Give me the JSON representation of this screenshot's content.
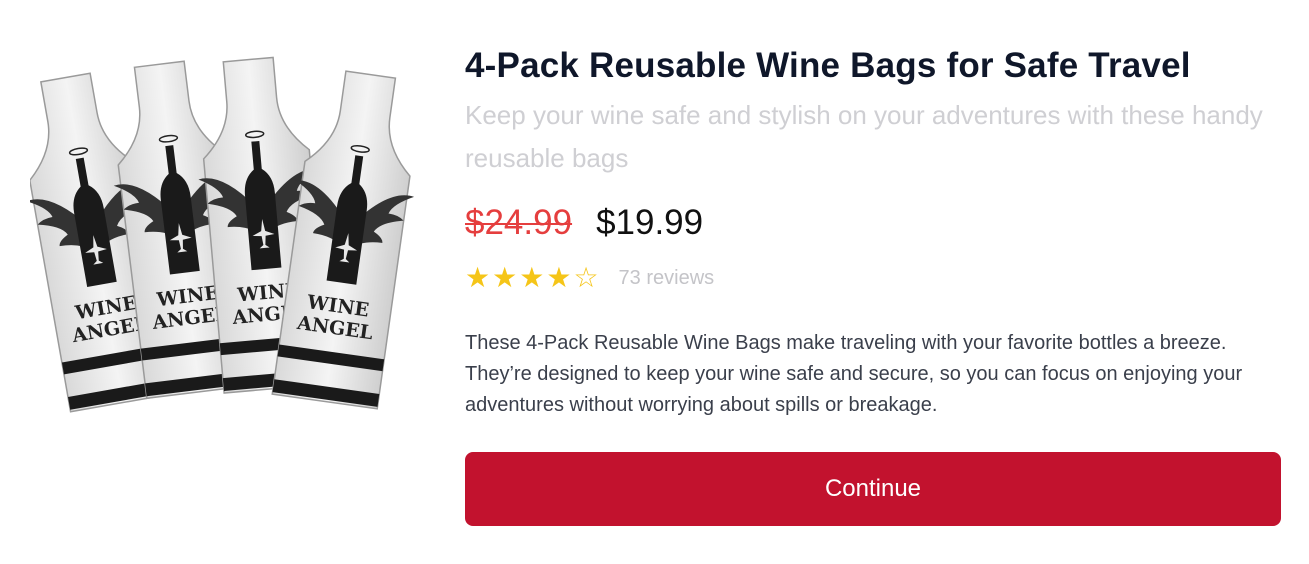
{
  "product": {
    "title": "4-Pack Reusable Wine Bags for Safe Travel",
    "subtitle": "Keep your wine safe and stylish on your adventures with these handy reusable bags",
    "original_price": "$24.99",
    "sale_price": "$19.99",
    "rating": 4,
    "rating_max": 5,
    "reviews_label": "73 reviews",
    "description": "These 4-Pack Reusable Wine Bags make traveling with your favorite bottles a breeze. They’re designed to keep your wine safe and secure, so you can focus on enjoying your adventures without worrying about spills or breakage.",
    "image": {
      "bag_label_line1": "WINE",
      "bag_label_line2": "ANGEL",
      "bag_count": 4
    }
  },
  "actions": {
    "continue_label": "Continue"
  },
  "colors": {
    "accent": "#c2122e",
    "strike_price": "#e53e3e",
    "star": "#f5c518"
  },
  "icons": {
    "star_full": "star-filled-icon",
    "star_empty": "star-outline-icon"
  }
}
